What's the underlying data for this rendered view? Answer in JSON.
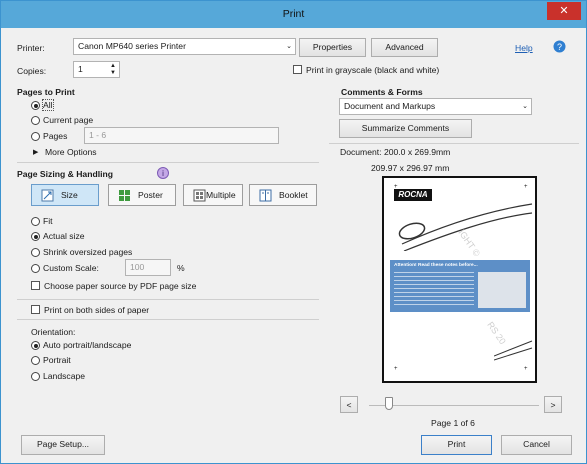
{
  "window": {
    "title": "Print",
    "close_glyph": "✕"
  },
  "printer": {
    "label": "Printer:",
    "value": "Canon MP640 series Printer",
    "properties_label": "Properties",
    "advanced_label": "Advanced",
    "help_label": "Help"
  },
  "copies": {
    "label": "Copies:",
    "value": "1"
  },
  "grayscale": {
    "label": "Print in grayscale (black and white)",
    "checked": false
  },
  "pages_to_print": {
    "title": "Pages to Print",
    "all": "All",
    "current": "Current page",
    "pages": "Pages",
    "pages_placeholder": "1 - 6",
    "more": "More Options",
    "selected": "all"
  },
  "sizing": {
    "title": "Page Sizing & Handling",
    "tools": [
      "Size",
      "Poster",
      "Multiple",
      "Booklet"
    ],
    "selected_tool": "Size",
    "fit": "Fit",
    "actual": "Actual size",
    "shrink": "Shrink oversized pages",
    "custom": "Custom Scale:",
    "custom_value": "100",
    "percent": "%",
    "paper_source": "Choose paper source by PDF page size",
    "both_sides": "Print on both sides of paper",
    "orientation_label": "Orientation:",
    "auto": "Auto portrait/landscape",
    "portrait": "Portrait",
    "landscape": "Landscape",
    "scaling_selected": "actual",
    "orientation_selected": "auto"
  },
  "comments": {
    "title": "Comments & Forms",
    "value": "Document and Markups",
    "summarize": "Summarize Comments"
  },
  "document": {
    "size_text": "Document: 200.0 x 269.9mm",
    "paper_text": "209.97 x 296.97 mm",
    "page_indicator": "Page 1 of 6",
    "prev": "<",
    "next": ">"
  },
  "preview": {
    "logo": "ROCNA",
    "watermark_1": "IGHT ©",
    "watermark_2": "RS 20",
    "banner": "Attention! Read these notes before...",
    "corner_marks": [
      "+",
      "+",
      "+",
      "+"
    ]
  },
  "footer": {
    "page_setup": "Page Setup...",
    "print": "Print",
    "cancel": "Cancel"
  },
  "colors": {
    "title_bar": "#56a8d9",
    "close": "#c9312b",
    "selected_tool": "#cfe6f7",
    "link": "#1e5fb4"
  }
}
